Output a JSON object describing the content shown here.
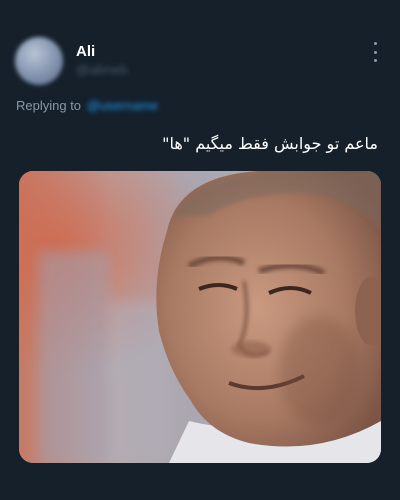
{
  "author": {
    "display_name": "Ali",
    "handle": "@alimeb"
  },
  "reply": {
    "prefix": "Replying to",
    "target": "@username"
  },
  "tweet": {
    "text": "ماعم تو جوابش فقط میگیم \"ها\""
  },
  "icons": {
    "more": "more-vertical-icon"
  },
  "colors": {
    "background": "#15202b",
    "link": "#1d9bf0",
    "secondary_text": "#8899a6"
  }
}
